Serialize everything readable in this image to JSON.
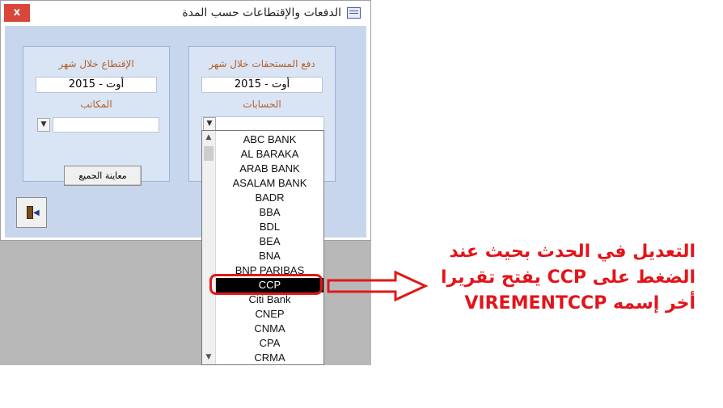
{
  "window": {
    "title": "الدفعات والإقتطاعات حسب المدة",
    "close_label": "x"
  },
  "left_group": {
    "heading": "الإقتطاع خلال شهر",
    "month_value": "أوت - 2015",
    "sub_label": "المكاتب",
    "combo_value": "",
    "preview_label": "معاينة الجميع"
  },
  "right_group": {
    "heading": "دفع المستحقات خلال شهر",
    "month_value": "أوت - 2015",
    "sub_label": "الحسابات",
    "combo_value": ""
  },
  "dropdown": {
    "items": [
      "ABC BANK",
      "AL BARAKA",
      "ARAB BANK",
      "ASALAM BANK",
      "BADR",
      "BBA",
      "BDL",
      "BEA",
      "BNA",
      "BNP PARIBAS",
      "CCP",
      "Citi Bank",
      "CNEP",
      "CNMA",
      "CPA",
      "CRMA"
    ],
    "selected_index": 10
  },
  "annotation": {
    "line1": "التعديل في الحدث بحيث عند",
    "line2": "الضغط على CCP يفتح تقريرا",
    "line3": "أخر إسمه VIREMENTCCP",
    "color": "#e3141b"
  },
  "icons": {
    "close": "close-icon",
    "form": "form-icon",
    "exit": "exit-door-icon",
    "dropdown": "chevron-down-icon"
  }
}
